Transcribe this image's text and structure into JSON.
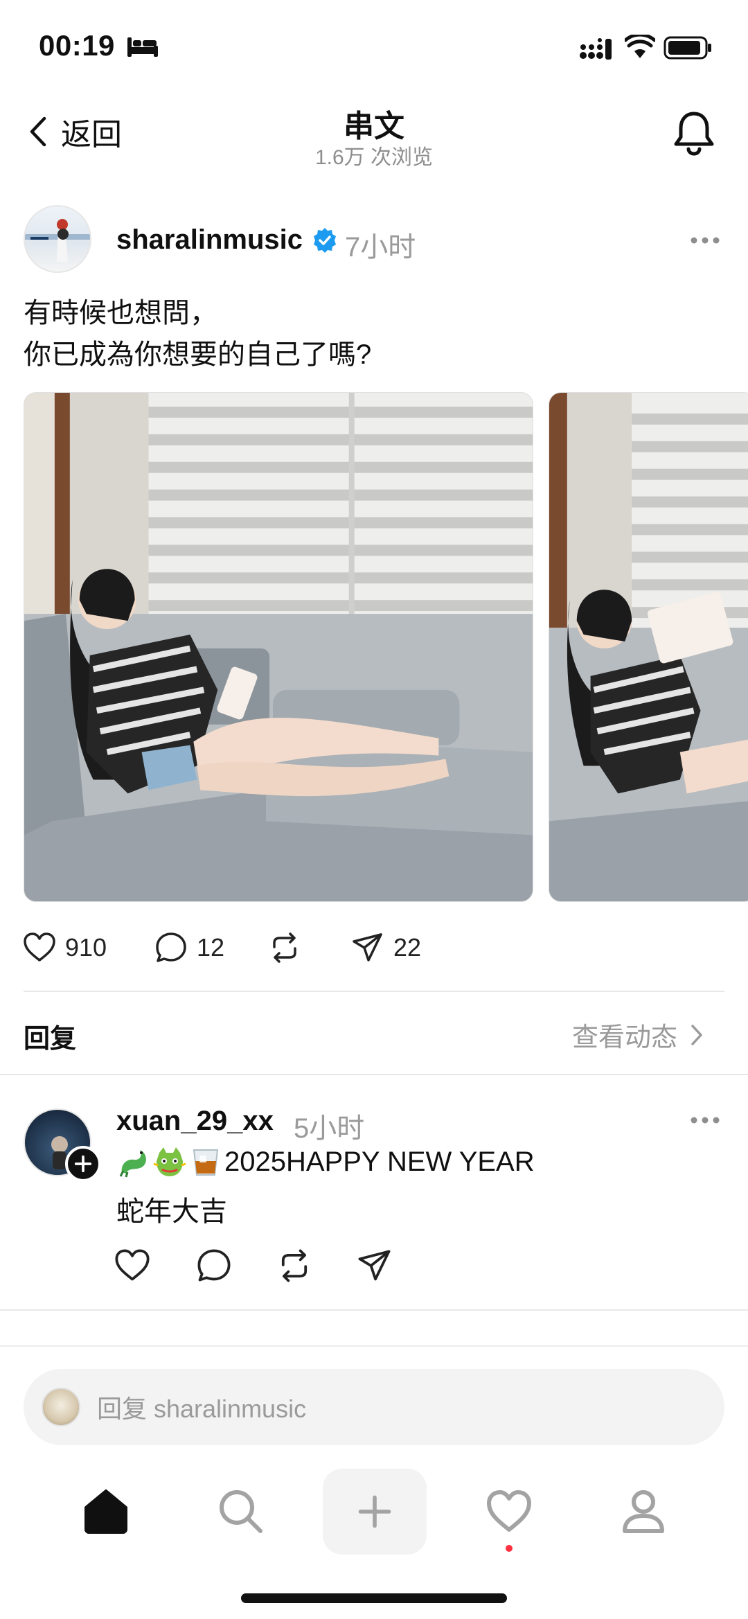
{
  "status_bar": {
    "time": "00:19"
  },
  "header": {
    "back_label": "返回",
    "title": "串文",
    "views": "1.6万 次浏览"
  },
  "post": {
    "username": "sharalinmusic",
    "time": "7小时",
    "text_line1": "有時候也想問，",
    "text_line2": "你已成為你想要的自己了嗎?",
    "likes": "910",
    "comments": "12",
    "shares": "22"
  },
  "replies_section": {
    "title": "回复",
    "view_activity": "查看动态"
  },
  "reply": {
    "username": "xuan_29_xx",
    "time": "5小时",
    "text_line1": "2025HAPPY NEW YEAR",
    "text_line2": "蛇年大吉"
  },
  "composer": {
    "placeholder": "回复 sharalinmusic"
  },
  "colors": {
    "verified": "#1d9bf0",
    "notification_dot": "#ff3040"
  },
  "icons": [
    "bed-icon",
    "signal-icon",
    "wifi-icon",
    "battery-icon",
    "back-chevron-icon",
    "bell-icon",
    "verified-icon",
    "more-icon",
    "heart-icon",
    "comment-icon",
    "repost-icon",
    "share-icon",
    "chevron-right-icon",
    "home-icon",
    "search-icon",
    "plus-icon",
    "profile-icon"
  ]
}
